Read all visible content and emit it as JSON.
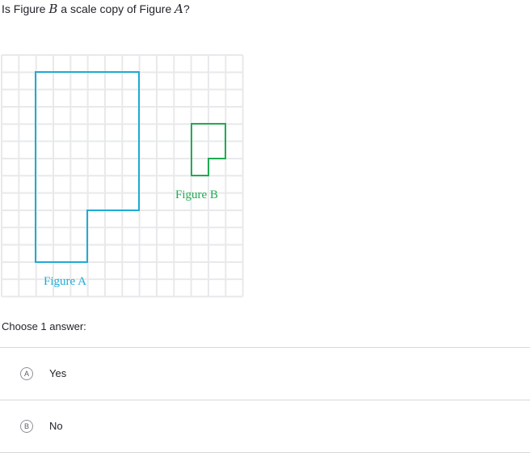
{
  "question": {
    "prefix": "Is Figure ",
    "var_b": "B",
    "middle": " a scale copy of Figure ",
    "var_a": "A",
    "suffix": "?"
  },
  "figures": {
    "a": {
      "label": "Figure A",
      "color": "#1fabd3"
    },
    "b": {
      "label": "Figure B",
      "color": "#1fab54"
    }
  },
  "prompt": "Choose 1 answer:",
  "choices": [
    {
      "letter": "A",
      "text": "Yes"
    },
    {
      "letter": "B",
      "text": "No"
    }
  ],
  "colors": {
    "grid": "#e8e9eb",
    "text": "#21242c",
    "divider": "#d6d8da"
  }
}
